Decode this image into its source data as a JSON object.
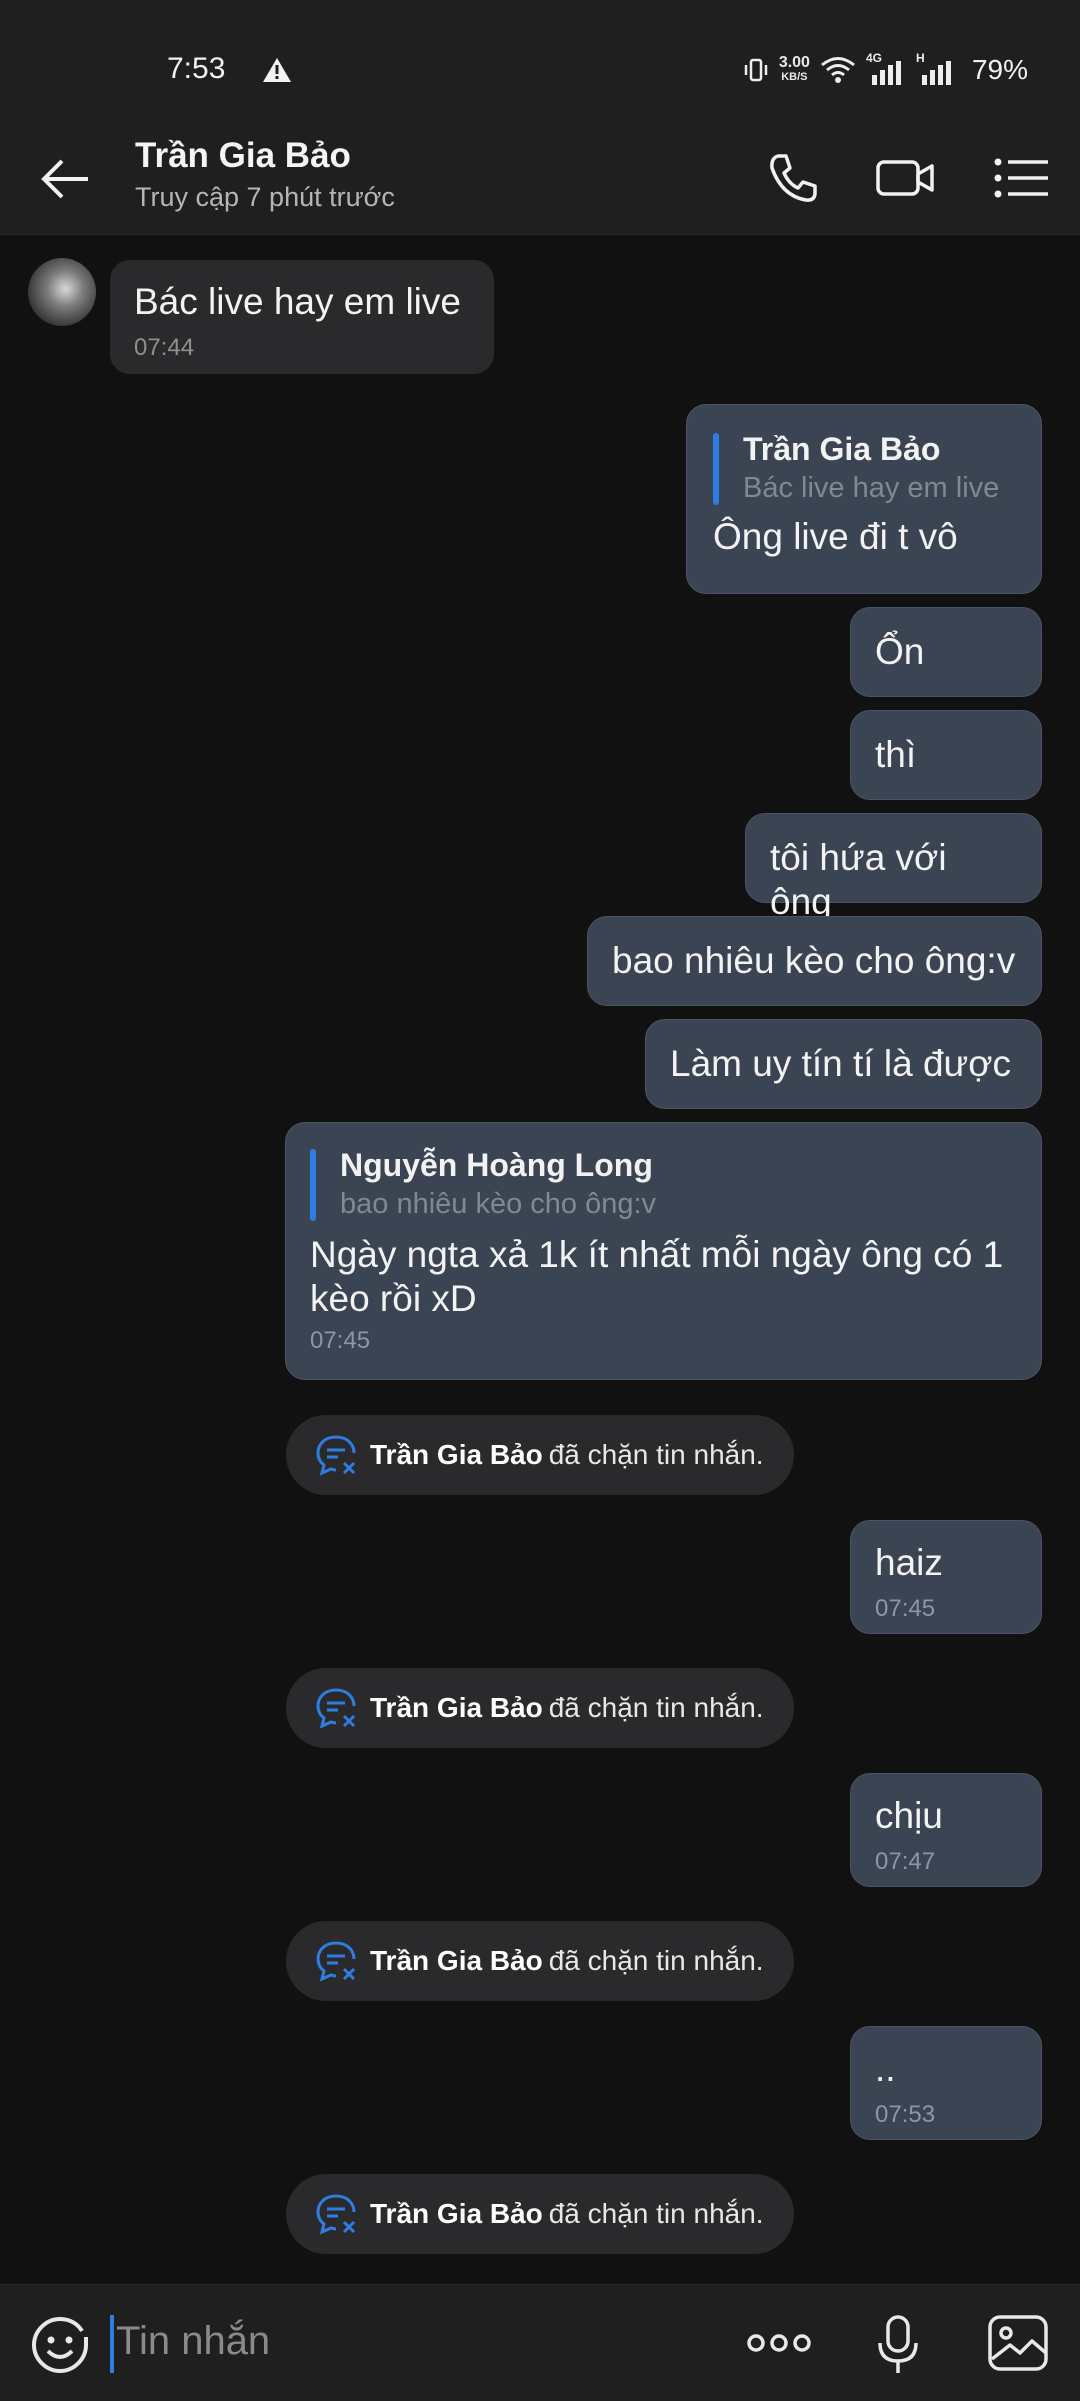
{
  "status_bar": {
    "time": "7:53",
    "net_speed_value": "3.00",
    "net_speed_unit": "KB/S",
    "net_type_1": "4G",
    "net_type_2": "H",
    "battery": "79%"
  },
  "header": {
    "name": "Trần Gia Bảo",
    "status": "Truy cập 7 phút trước"
  },
  "messages": {
    "m1": {
      "text": "Bác live hay em live",
      "time": "07:44"
    },
    "m2": {
      "quote_name": "Trần Gia Bảo",
      "quote_text": "Bác live hay em live",
      "text": "Ông live đi t vô"
    },
    "m3": {
      "text": "Ổn"
    },
    "m4": {
      "text": "thì"
    },
    "m5": {
      "text": "tôi hứa với ông"
    },
    "m6": {
      "text": "bao nhiêu kèo cho ông:v"
    },
    "m7": {
      "text": "Làm uy tín tí là được"
    },
    "m8": {
      "quote_name": "Nguyễn Hoàng Long",
      "quote_text": "bao nhiêu kèo cho ông:v",
      "text": "Ngày ngta xả 1k ít nhất mỗi ngày ông có 1 kèo rồi xD",
      "time": "07:45"
    },
    "m9": {
      "text": "haiz",
      "time": "07:45"
    },
    "m10": {
      "text": "chịu",
      "time": "07:47"
    },
    "m11": {
      "text": "..",
      "time": "07:53"
    }
  },
  "system": {
    "name": "Trần Gia Bảo",
    "text": "đã chặn tin nhắn."
  },
  "input": {
    "placeholder": "Tin nhắn"
  },
  "colors": {
    "accent": "#2f7de1",
    "outgoing_bubble": "#3b4453",
    "incoming_bubble": "#2a2a2c"
  }
}
